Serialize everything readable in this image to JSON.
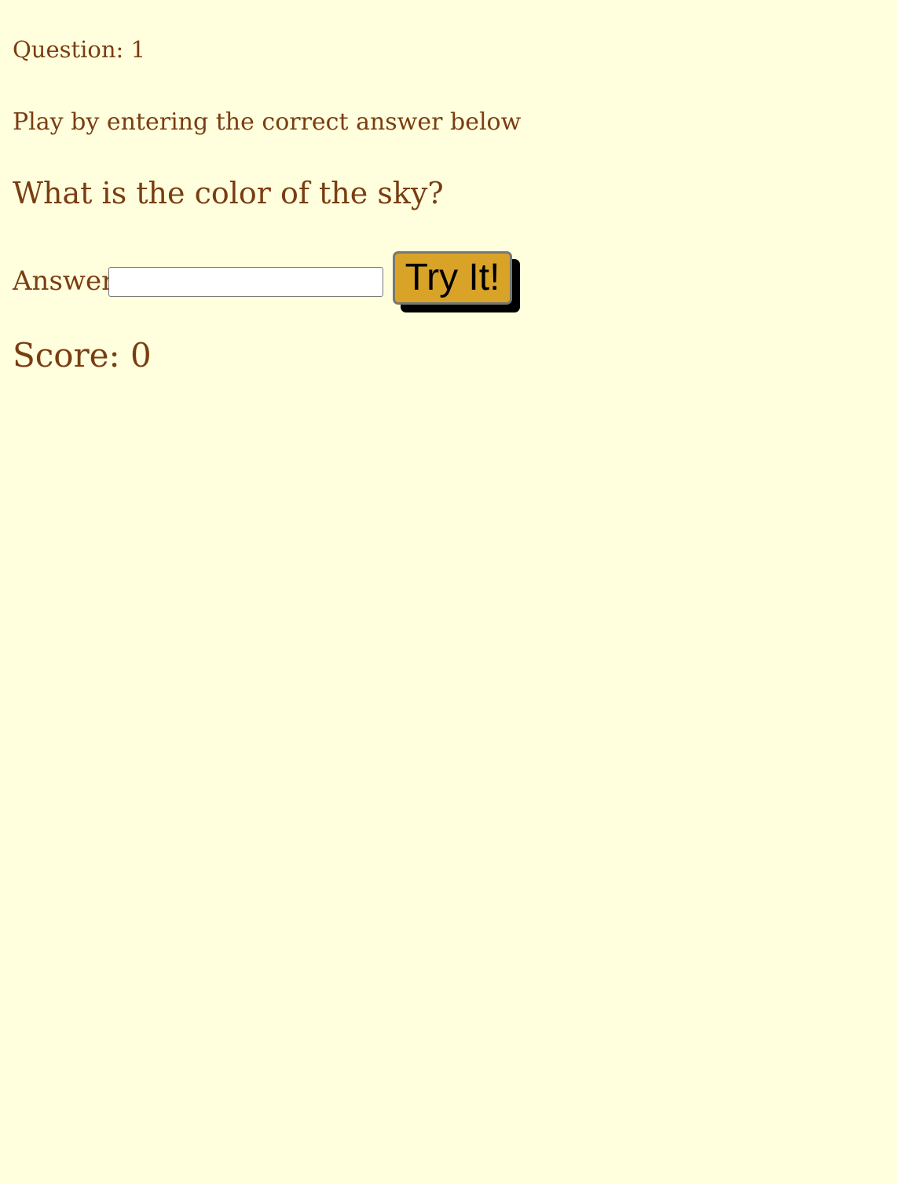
{
  "question": {
    "label": "Question:",
    "number": "1"
  },
  "instructions": "Play by entering the correct answer below",
  "prompt": "What is the color of the sky?",
  "answer": {
    "label": "Answer:",
    "value": "",
    "button_label": "Try It!"
  },
  "score": {
    "label": "Score:",
    "value": "0"
  },
  "colors": {
    "background": "#ffffdd",
    "text": "#7a3d12",
    "button": "#d9a328",
    "button_shadow": "#000000"
  }
}
